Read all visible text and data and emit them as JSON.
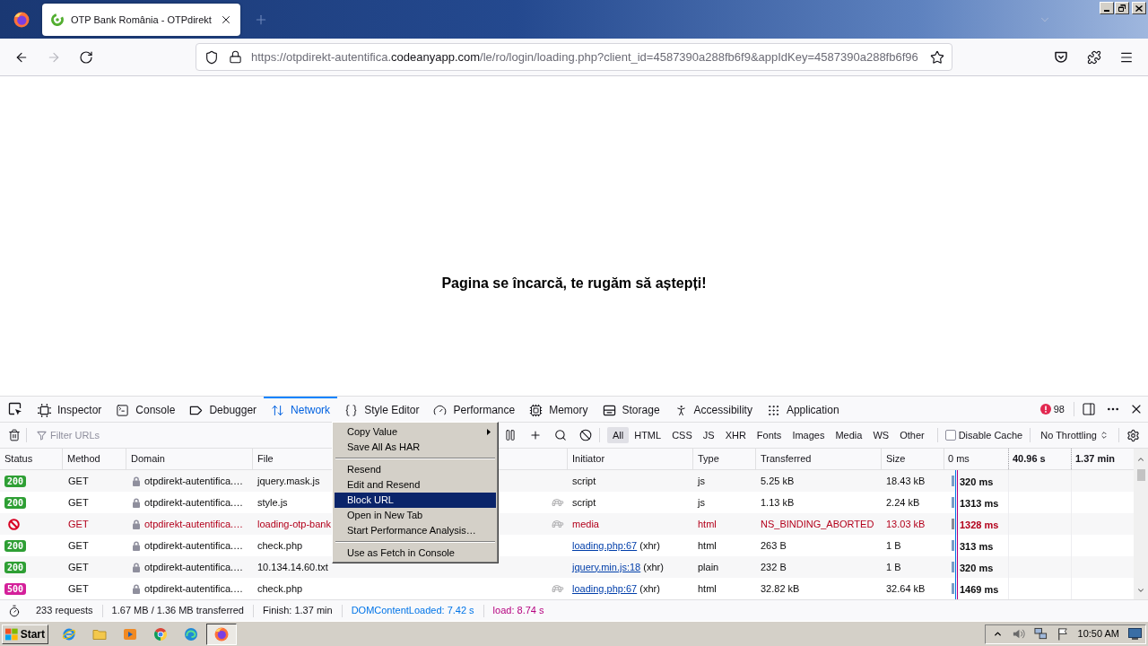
{
  "browser": {
    "tabs": [
      {
        "title": "OTP Bank România - OTPdirekt",
        "selected": true
      }
    ],
    "nav": [
      {
        "kind": "back",
        "disabled": false
      },
      {
        "kind": "forward",
        "disabled": true
      },
      {
        "kind": "reload",
        "disabled": false
      }
    ],
    "address": {
      "prefix": "https://otpdirekt-autentifica.",
      "domain": "codeanyapp.com",
      "suffix": "/le/ro/login/loading.php?client_id=4587390a288fb6f9&appIdKey=4587390a288fb6f96"
    }
  },
  "page": {
    "message": "Pagina se încarcă, te rugăm să aștepți!"
  },
  "devtools": {
    "tabs": [
      {
        "kind": "inspector",
        "label": "Inspector",
        "selected": false
      },
      {
        "kind": "console",
        "label": "Console",
        "selected": false
      },
      {
        "kind": "debugger",
        "label": "Debugger",
        "selected": false
      },
      {
        "kind": "network",
        "label": "Network",
        "selected": true
      },
      {
        "kind": "style",
        "label": "Style Editor",
        "selected": false
      },
      {
        "kind": "performance",
        "label": "Performance",
        "selected": false
      },
      {
        "kind": "memory",
        "label": "Memory",
        "selected": false
      },
      {
        "kind": "storage",
        "label": "Storage",
        "selected": false
      },
      {
        "kind": "accessibility",
        "label": "Accessibility",
        "selected": false
      },
      {
        "kind": "application",
        "label": "Application",
        "selected": false
      }
    ],
    "error_count": "98",
    "filter": {
      "placeholder": "Filter URLs"
    },
    "type_filters": [
      {
        "label": "All",
        "selected": true
      },
      {
        "label": "HTML",
        "selected": false
      },
      {
        "label": "CSS",
        "selected": false
      },
      {
        "label": "JS",
        "selected": false
      },
      {
        "label": "XHR",
        "selected": false
      },
      {
        "label": "Fonts",
        "selected": false
      },
      {
        "label": "Images",
        "selected": false
      },
      {
        "label": "Media",
        "selected": false
      },
      {
        "label": "WS",
        "selected": false
      },
      {
        "label": "Other",
        "selected": false
      }
    ],
    "disable_cache": {
      "label": "Disable Cache",
      "checked": false
    },
    "throttling": {
      "value": "No Throttling"
    },
    "columns": [
      "Status",
      "Method",
      "Domain",
      "File",
      "Initiator",
      "Type",
      "Transferred",
      "Size"
    ],
    "timeline": [
      "0 ms",
      "40.96 s",
      "1.37 min"
    ],
    "requests": [
      {
        "status": {
          "kind": "badge",
          "text": "200",
          "color": "#2e9f34"
        },
        "method": "GET",
        "domain": "otpdirekt-autentifica.…",
        "file": "jquery.mask.js",
        "slow": false,
        "initiator": {
          "text": "script"
        },
        "type": "js",
        "transferred": "5.25 kB",
        "size": "18.43 kB",
        "timing": "320 ms",
        "failed": false
      },
      {
        "status": {
          "kind": "badge",
          "text": "200",
          "color": "#2e9f34"
        },
        "method": "GET",
        "domain": "otpdirekt-autentifica.…",
        "file": "style.js",
        "slow": true,
        "initiator": {
          "text": "script"
        },
        "type": "js",
        "transferred": "1.13 kB",
        "size": "2.24 kB",
        "timing": "1313 ms",
        "failed": false
      },
      {
        "status": {
          "kind": "blocked"
        },
        "method": "GET",
        "domain": "otpdirekt-autentifica.…",
        "file": "loading-otp-bank",
        "slow": true,
        "initiator": {
          "text": "media"
        },
        "type": "html",
        "transferred": "NS_BINDING_ABORTED",
        "size": "13.03 kB",
        "timing": "1328 ms",
        "failed": true
      },
      {
        "status": {
          "kind": "badge",
          "text": "200",
          "color": "#2e9f34"
        },
        "method": "GET",
        "domain": "otpdirekt-autentifica.…",
        "file": "check.php",
        "slow": false,
        "initiator": {
          "link": "loading.php:67",
          "text": "(xhr)"
        },
        "type": "html",
        "transferred": "263 B",
        "size": "1 B",
        "timing": "313 ms",
        "failed": false
      },
      {
        "status": {
          "kind": "badge",
          "text": "200",
          "color": "#2e9f34"
        },
        "method": "GET",
        "domain": "otpdirekt-autentifica.…",
        "file": "10.134.14.60.txt",
        "slow": false,
        "initiator": {
          "link": "jquery.min.js:18",
          "text": "(xhr)"
        },
        "type": "plain",
        "transferred": "232 B",
        "size": "1 B",
        "timing": "320 ms",
        "failed": false
      },
      {
        "status": {
          "kind": "badge",
          "text": "500",
          "color": "#d4209a"
        },
        "method": "GET",
        "domain": "otpdirekt-autentifica.…",
        "file": "check.php",
        "slow": true,
        "initiator": {
          "link": "loading.php:67",
          "text": "(xhr)"
        },
        "type": "html",
        "transferred": "32.82 kB",
        "size": "32.64 kB",
        "timing": "1469 ms",
        "failed": false
      }
    ],
    "summary": [
      {
        "text": "233 requests"
      },
      {
        "text": "1.67 MB / 1.36 MB transferred"
      },
      {
        "text": "Finish: 1.37 min"
      },
      {
        "text": "DOMContentLoaded: 7.42 s",
        "color": "#0074e8"
      },
      {
        "text": "load: 8.74 s",
        "color": "#b5007f"
      }
    ]
  },
  "context_menu": {
    "items": [
      {
        "kind": "item",
        "label": "Copy Value",
        "submenu": true,
        "selected": false
      },
      {
        "kind": "item",
        "label": "Save All As HAR",
        "submenu": false,
        "selected": false
      },
      {
        "kind": "separator"
      },
      {
        "kind": "item",
        "label": "Resend",
        "submenu": false,
        "selected": false
      },
      {
        "kind": "item",
        "label": "Edit and Resend",
        "submenu": false,
        "selected": false
      },
      {
        "kind": "item",
        "label": "Block URL",
        "submenu": false,
        "selected": true
      },
      {
        "kind": "item",
        "label": "Open in New Tab",
        "submenu": false,
        "selected": false
      },
      {
        "kind": "item",
        "label": "Start Performance Analysis…",
        "submenu": false,
        "selected": false
      },
      {
        "kind": "separator"
      },
      {
        "kind": "item",
        "label": "Use as Fetch in Console",
        "submenu": false,
        "selected": false
      }
    ]
  },
  "taskbar": {
    "start": "Start",
    "apps": [
      {
        "kind": "ie",
        "selected": false
      },
      {
        "kind": "folder",
        "selected": false
      },
      {
        "kind": "player",
        "selected": false
      },
      {
        "kind": "chrome",
        "selected": false
      },
      {
        "kind": "edge",
        "selected": false
      },
      {
        "kind": "firefox",
        "selected": true
      }
    ],
    "clock": "10:50 AM"
  }
}
